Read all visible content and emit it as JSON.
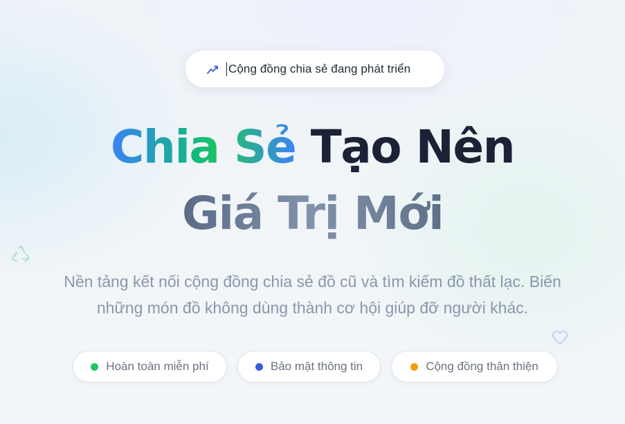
{
  "badge": {
    "icon": "trending-up-icon",
    "text": "Cộng đồng chia sẻ đang phát triển"
  },
  "hero": {
    "title_gradient": "Chia Sẻ",
    "title_dark": "Tạo Nên",
    "title_line2": "Giá Trị Mới",
    "description_line1": "Nền tảng kết nối cộng đồng chia sẻ đồ cũ và tìm kiếm đồ thất lạc. Biến",
    "description_line2": "những món đồ không dùng thành cơ hội giúp đỡ người khác."
  },
  "features": [
    {
      "label": "Hoàn toàn miễn phí",
      "dot_color": "#22c55e"
    },
    {
      "label": "Bảo mật thông tin",
      "dot_color": "#3b5bdb"
    },
    {
      "label": "Cộng đồng thân thiện",
      "dot_color": "#f59e0b"
    }
  ],
  "decorations": {
    "left_icon": "recycle-icon",
    "right_icon": "heart-icon"
  },
  "colors": {
    "gradient_start": "#3b82f6",
    "gradient_mid": "#10b981",
    "title_dark": "#1b2235",
    "description": "#8a97ab"
  }
}
